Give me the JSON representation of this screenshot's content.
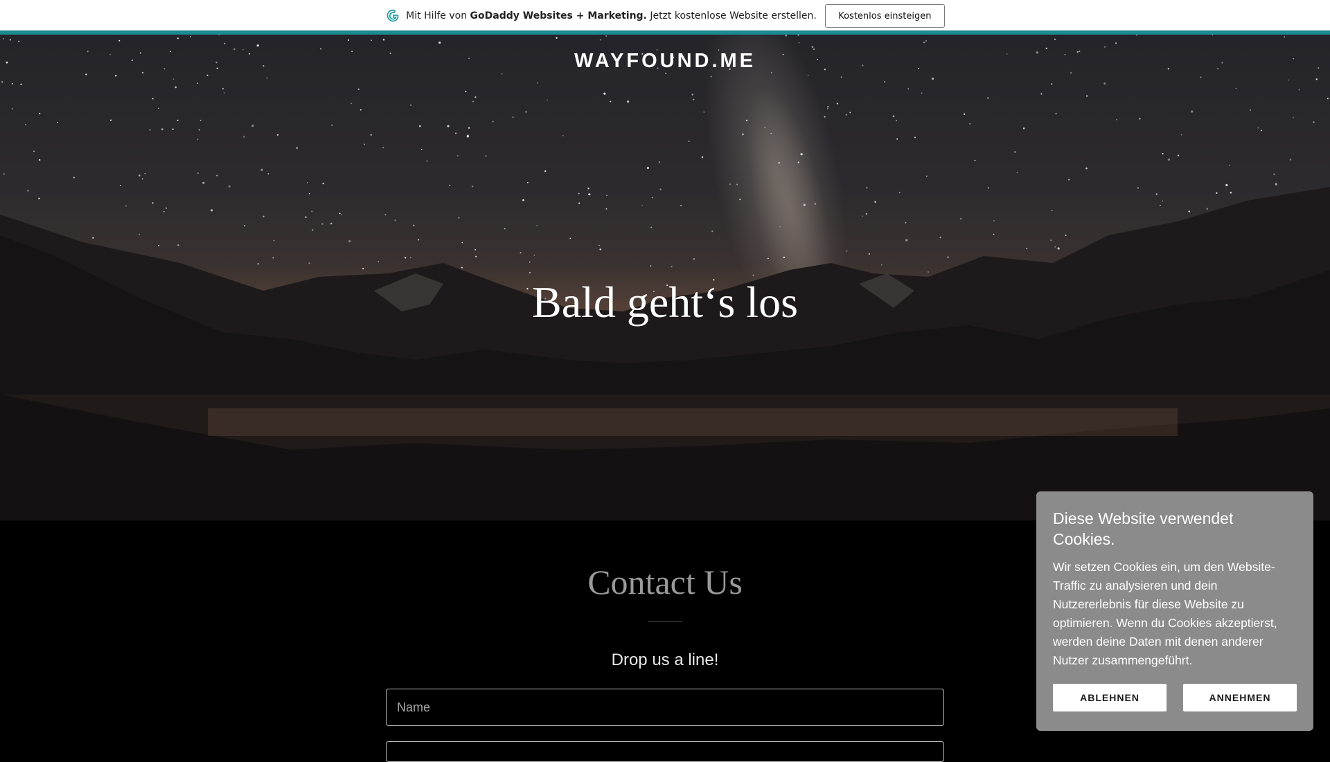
{
  "promo": {
    "prefix": "Mit Hilfe von",
    "brand": "GoDaddy Websites + Marketing.",
    "suffix": "Jetzt kostenlose Website erstellen.",
    "button_label": "Kostenlos einsteigen",
    "accent_color": "#1c8c92"
  },
  "hero": {
    "site_title": "WAYFOUND.ME",
    "heading": "Bald geht‘s los"
  },
  "contact": {
    "title": "Contact Us",
    "subtitle": "Drop us a line!",
    "name_placeholder": "Name"
  },
  "cookie_banner": {
    "title": "Diese Website verwendet Cookies.",
    "text": "Wir setzen Cookies ein, um den Website-Traffic zu analysieren und dein Nutzererlebnis für diese Website zu optimieren. Wenn du Cookies akzeptierst, werden deine Daten mit denen anderer Nutzer zusammengeführt.",
    "decline_label": "ABLEHNEN",
    "accept_label": "ANNEHMEN",
    "background_color": "#8b8b8b"
  }
}
